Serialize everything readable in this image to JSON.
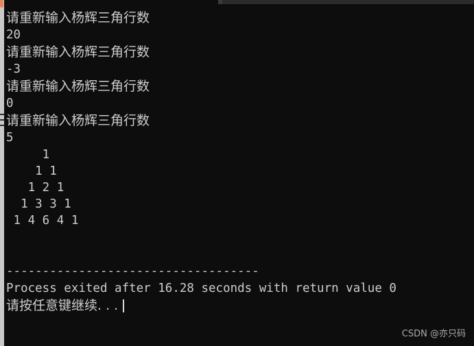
{
  "window": {
    "background_color": "#0d0d0d",
    "text_color": "#cdcdcd",
    "accent_color": "#e08a63",
    "strip_color": "#c9c9c9",
    "top_band_color": "#2b2b2b"
  },
  "console": {
    "prompt_1": "请重新输入杨辉三角行数",
    "input_1": "20",
    "prompt_2": "请重新输入杨辉三角行数",
    "input_2": "-3",
    "prompt_3": "请重新输入杨辉三角行数",
    "input_3": "0",
    "prompt_4": "请重新输入杨辉三角行数",
    "input_4": "5",
    "blank_1": " ",
    "separator": "-----------------------------------",
    "exit_message": "Process exited after 16.28 seconds with return value 0",
    "press_any_key": "请按任意键继续. . .",
    "caret": "|"
  },
  "triangle": {
    "rows": [
      "     1",
      "    1 1",
      "   1 2 1",
      "  1 3 3 1",
      " 1 4 6 4 1"
    ],
    "values": [
      [
        1
      ],
      [
        1,
        1
      ],
      [
        1,
        2,
        1
      ],
      [
        1,
        3,
        3,
        1
      ],
      [
        1,
        4,
        6,
        4,
        1
      ]
    ],
    "row_count": 5
  },
  "watermark": {
    "text": "CSDN @亦只码"
  }
}
